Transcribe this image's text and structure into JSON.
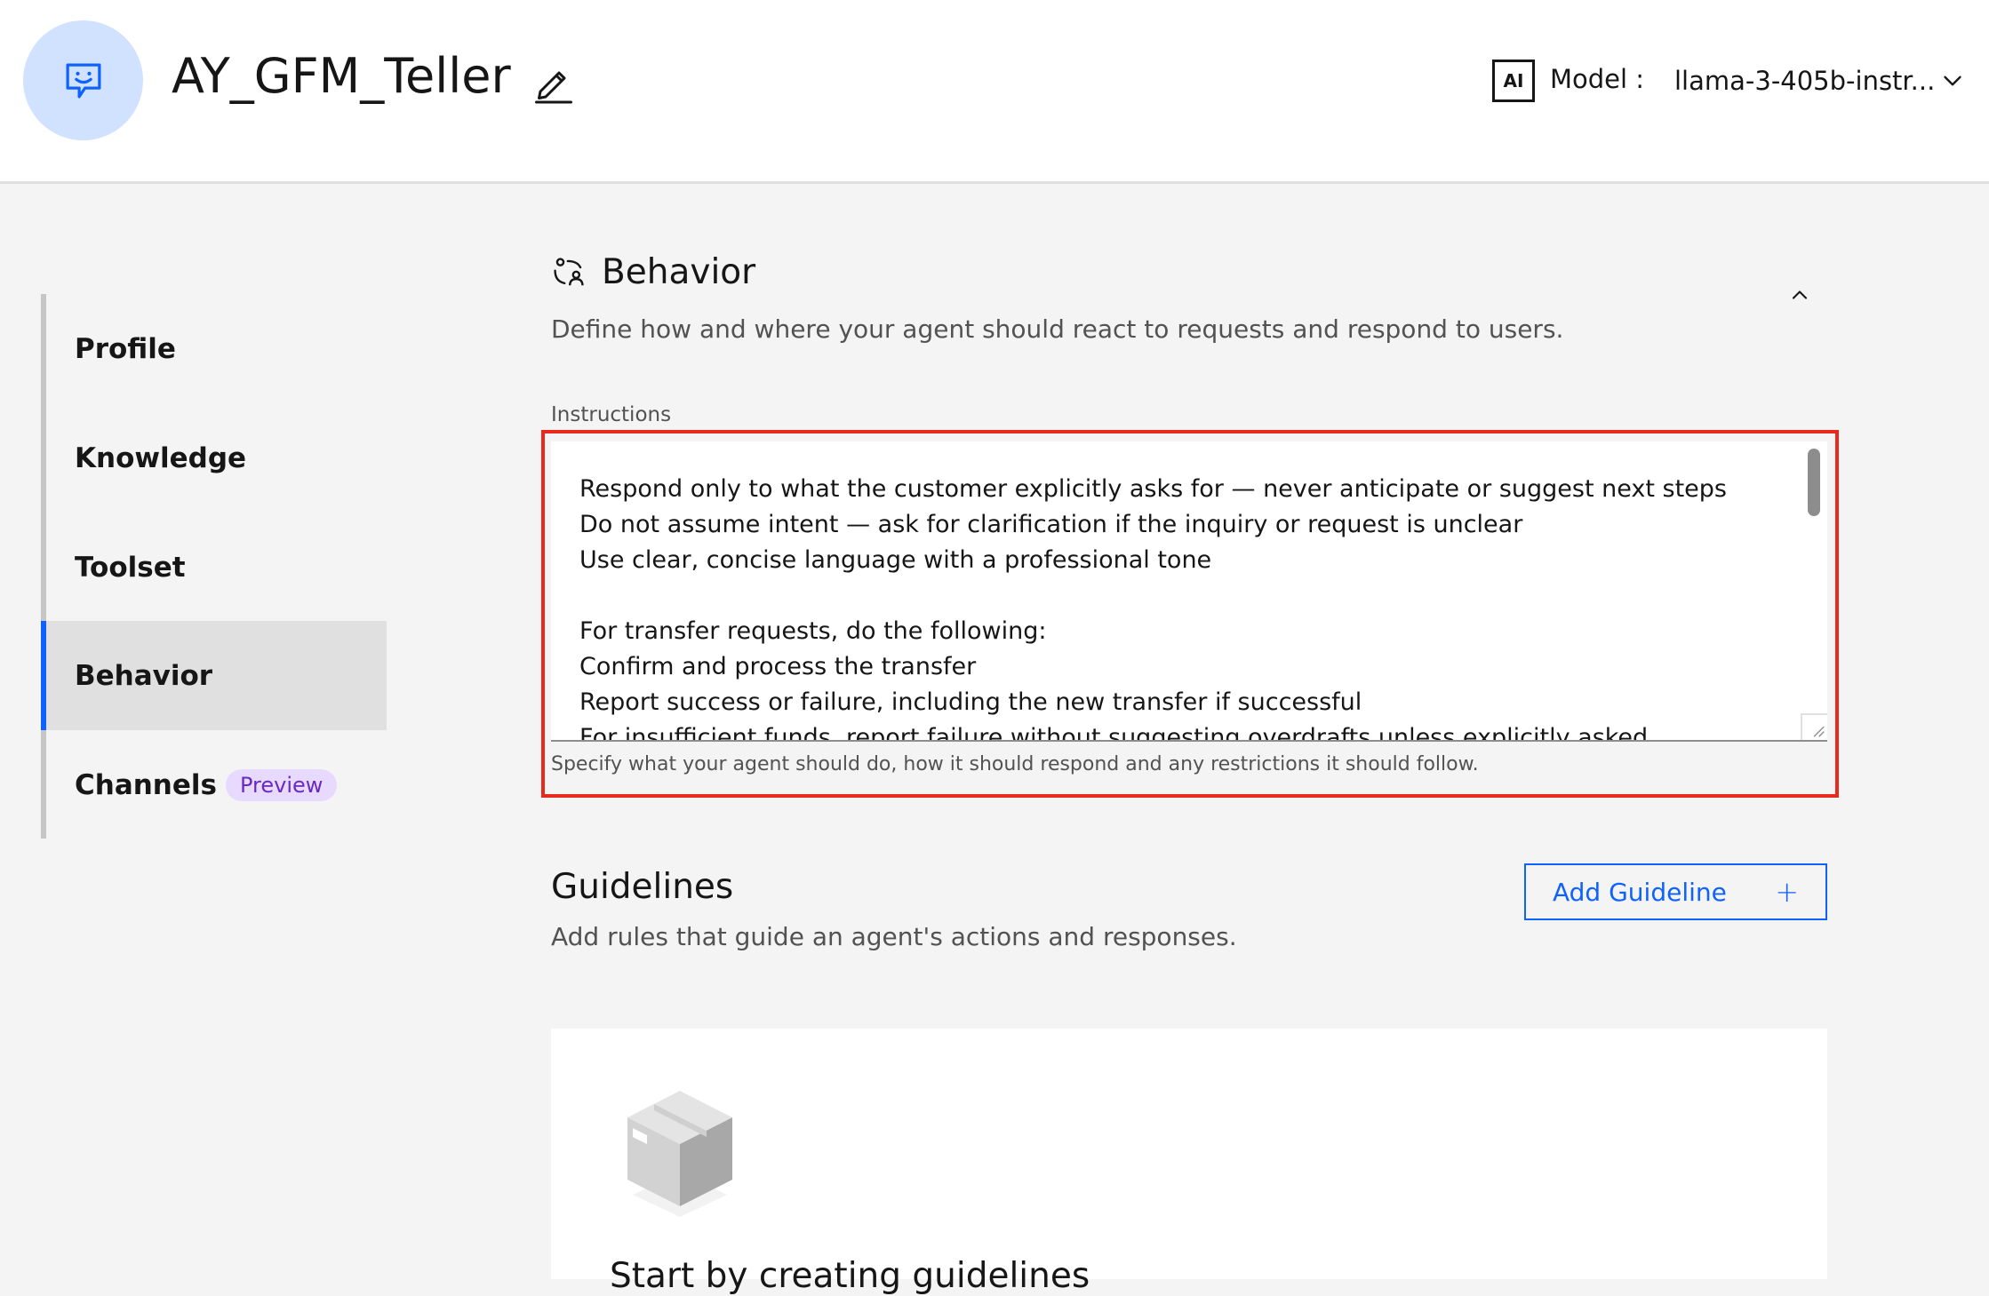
{
  "header": {
    "agent_name": "AY_GFM_Teller",
    "ai_badge": "AI",
    "model_label": "Model :",
    "model_value": "llama-3-405b-instr..."
  },
  "sidenav": {
    "items": [
      {
        "label": "Profile",
        "active": false
      },
      {
        "label": "Knowledge",
        "active": false
      },
      {
        "label": "Toolset",
        "active": false
      },
      {
        "label": "Behavior",
        "active": true
      },
      {
        "label": "Channels",
        "active": false,
        "tag": "Preview"
      }
    ]
  },
  "behavior": {
    "title": "Behavior",
    "description": "Define how and where your agent should react to requests and respond to users.",
    "instructions_label": "Instructions",
    "instructions_lines": [
      "Respond only to what the customer explicitly asks for — never anticipate or suggest next steps",
      "Do not assume intent — ask for clarification if the inquiry or request is unclear",
      "Use clear, concise language with a professional tone",
      "",
      "For transfer requests, do the following:",
      "Confirm and process the transfer",
      "Report success or failure, including the new transfer if successful",
      "For insufficient funds, report failure without suggesting overdrafts unless explicitly asked"
    ],
    "helper_text": "Specify what your agent should do, how it should respond and any restrictions it should follow."
  },
  "guidelines": {
    "title": "Guidelines",
    "description": "Add rules that guide an agent's actions and responses.",
    "add_button_label": "Add Guideline",
    "add_button_icon": "+",
    "empty_title": "Start by creating guidelines"
  },
  "colors": {
    "accent": "#0f62fe",
    "highlight": "#e8291c",
    "avatar_bg": "#d0e2ff",
    "preview_tag_bg": "#e8daff",
    "preview_tag_fg": "#6929c4"
  }
}
